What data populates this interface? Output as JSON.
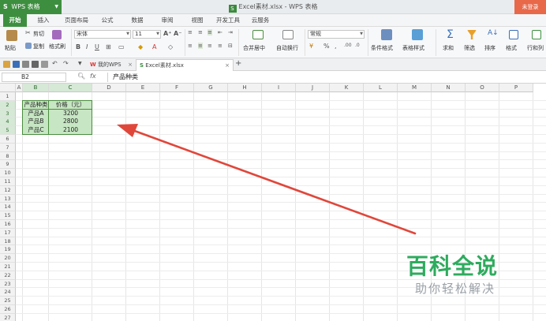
{
  "titlebar": {
    "app_button": "WPS 表格",
    "document_title": "Excel素材.xlsx - WPS 表格",
    "login_button": "未登录"
  },
  "menu": {
    "tabs": [
      "开始",
      "插入",
      "页面布局",
      "公式",
      "数据",
      "审阅",
      "视图",
      "开发工具",
      "云服务"
    ],
    "active_tab": "开始"
  },
  "ribbon": {
    "paste": "粘贴",
    "cut": "剪切",
    "copy": "复制",
    "format_painter": "格式刷",
    "font_name": "宋体",
    "font_size": "11",
    "merge_center": "合并居中",
    "wrap_text": "自动换行",
    "number_format": "常规",
    "conditional_format": "条件格式",
    "table_style": "表格样式",
    "sum": "求和",
    "filter": "筛选",
    "sort": "排序",
    "format": "格式",
    "row_col": "行和列"
  },
  "doc_tabs": {
    "tab1": "我的WPS",
    "tab2": "Excel素材.xlsx",
    "add": "+"
  },
  "formula_bar": {
    "name_box": "B2",
    "fx": "fx",
    "content": "产品种类"
  },
  "columns": [
    "A",
    "B",
    "C",
    "D",
    "E",
    "F",
    "G",
    "H",
    "I",
    "J",
    "K",
    "L",
    "M",
    "N",
    "O",
    "P"
  ],
  "rows": [
    "1",
    "2",
    "3",
    "4",
    "5",
    "6",
    "7",
    "8",
    "9",
    "10",
    "11",
    "12",
    "13",
    "14",
    "15",
    "16",
    "17",
    "18",
    "19",
    "20",
    "21",
    "22",
    "23",
    "24",
    "25",
    "26",
    "27"
  ],
  "table": {
    "header": [
      "产品种类",
      "价格（元）"
    ],
    "rows": [
      [
        "产品A",
        "3200"
      ],
      [
        "产品B",
        "2800"
      ],
      [
        "产品C",
        "2100"
      ]
    ]
  },
  "watermark": {
    "title": "百科全说",
    "subtitle": "助你轻松解决"
  },
  "colors": {
    "accent": "#3d8f3f",
    "selection_fill": "#c7e6c3",
    "arrow": "#e0473b",
    "watermark_green": "#2eab5e"
  }
}
